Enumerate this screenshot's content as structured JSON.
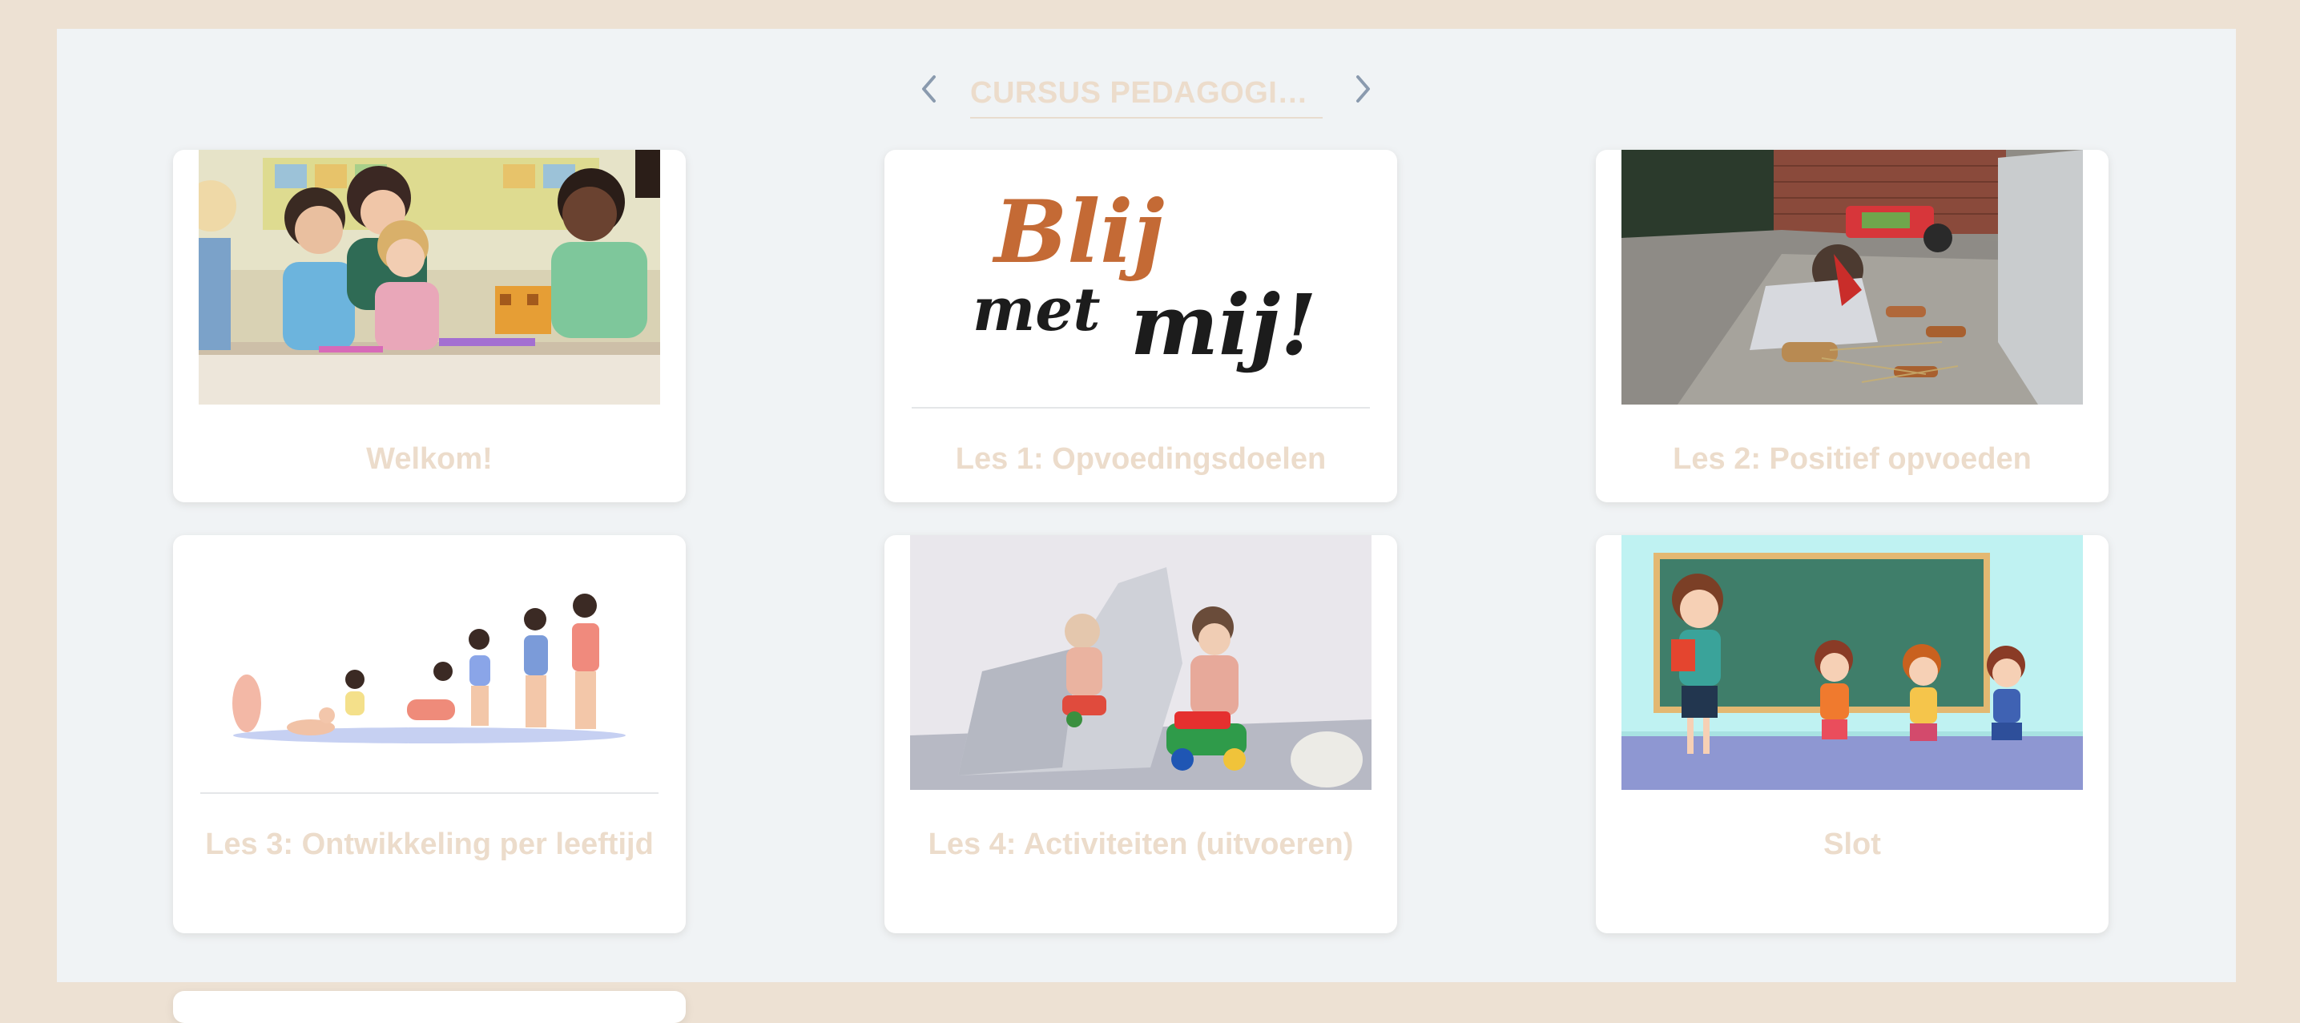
{
  "header": {
    "title": "CURSUS PEDAGOGIE...",
    "prev_icon": "chevron-left-icon",
    "next_icon": "chevron-right-icon"
  },
  "colors": {
    "page_background": "#ede1d3",
    "panel_background": "#f0f3f5",
    "card_background": "#ffffff",
    "title_text": "#ecdccb",
    "nav_arrow": "#8a9aae"
  },
  "lessons": [
    {
      "title": "Welkom!",
      "image": "classroom-children-photo"
    },
    {
      "title": "Les 1: Opvoedingsdoelen",
      "image": "blij-met-mij-logo",
      "logo_text": [
        "Blij",
        "met",
        "mij!"
      ]
    },
    {
      "title": "Les 2: Positief opvoeden",
      "image": "child-playing-outdoors-photo"
    },
    {
      "title": "Les 3: Ontwikkeling per leeftijd",
      "image": "child-growth-stages-illustration"
    },
    {
      "title": "Les 4: Activiteiten (uitvoeren)",
      "image": "toddlers-playing-photo"
    },
    {
      "title": "Slot",
      "image": "teacher-and-kids-illustration"
    }
  ]
}
